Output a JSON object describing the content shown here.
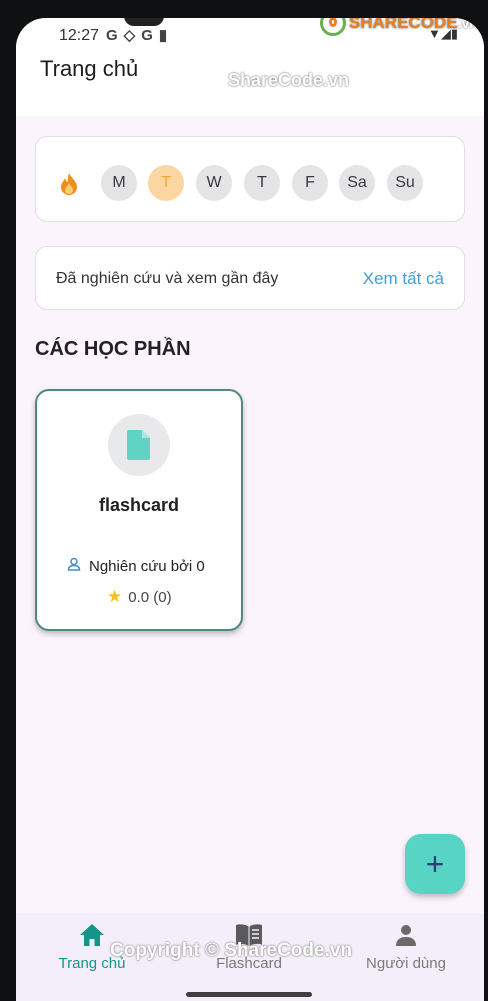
{
  "status_bar": {
    "time": "12:27",
    "icons": [
      "google-g-icon",
      "shield-icon",
      "google-g-icon",
      "sd-card-icon"
    ],
    "right_icons": [
      "wifi-icon",
      "signal-icon",
      "battery-icon"
    ]
  },
  "watermark": {
    "logo_brand": "SHARECODE",
    "logo_suffix": ".vn",
    "top": "ShareCode.vn",
    "bottom": "Copyright © ShareCode.vn"
  },
  "appbar": {
    "title": "Trang chủ"
  },
  "streak": {
    "icon": "flame-icon",
    "days": [
      {
        "label": "M",
        "active": false
      },
      {
        "label": "T",
        "active": true
      },
      {
        "label": "W",
        "active": false
      },
      {
        "label": "T",
        "active": false
      },
      {
        "label": "F",
        "active": false
      },
      {
        "label": "Sa",
        "active": false
      },
      {
        "label": "Su",
        "active": false
      }
    ]
  },
  "recent": {
    "text": "Đã nghiên cứu và xem gần đây",
    "see_all": "Xem tất cả"
  },
  "sections": {
    "title": "CÁC HỌC PHẦN"
  },
  "study_sets": [
    {
      "title": "flashcard",
      "studied_by": "Nghiên cứu bởi 0",
      "rating": "0.0 (0)"
    }
  ],
  "fab": {
    "label": "+"
  },
  "bottom_nav": [
    {
      "label": "Trang chủ",
      "icon": "home-icon",
      "active": true
    },
    {
      "label": "Flashcard",
      "icon": "book-icon",
      "active": false
    },
    {
      "label": "Người dùng",
      "icon": "person-icon",
      "active": false
    }
  ],
  "colors": {
    "accent": "#14958c",
    "fab": "#57d4c4",
    "link": "#3f9fd6",
    "day_active_bg": "#fcd6a0",
    "card_border": "#4e8a83"
  }
}
